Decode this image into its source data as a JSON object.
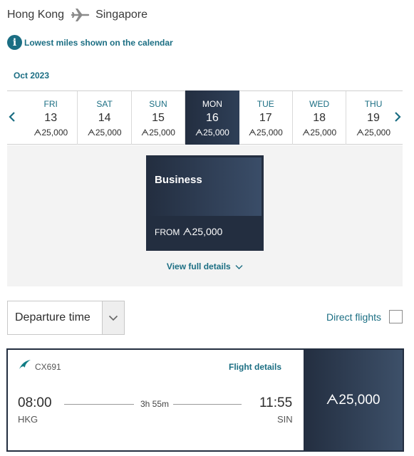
{
  "route": {
    "origin": "Hong Kong",
    "destination": "Singapore",
    "icon": "plane-icon"
  },
  "info": {
    "icon": "info-icon",
    "text": "Lowest miles shown on the calendar"
  },
  "calendar": {
    "month": "Oct 2023",
    "days": [
      {
        "dow": "FRI",
        "date": "13",
        "miles": "ᗅ25,000"
      },
      {
        "dow": "SAT",
        "date": "14",
        "miles": "ᗅ25,000"
      },
      {
        "dow": "SUN",
        "date": "15",
        "miles": "ᗅ25,000"
      },
      {
        "dow": "MON",
        "date": "16",
        "miles": "ᗅ25,000",
        "selected": true
      },
      {
        "dow": "TUE",
        "date": "17",
        "miles": "ᗅ25,000"
      },
      {
        "dow": "WED",
        "date": "18",
        "miles": "ᗅ25,000"
      },
      {
        "dow": "THU",
        "date": "19",
        "miles": "ᗅ25,000"
      }
    ]
  },
  "cabin_card": {
    "cabin": "Business",
    "from_label": "FROM",
    "price": "ᗅ25,000",
    "view_details": "View full details"
  },
  "filters": {
    "sort_value": "Departure time",
    "direct_label": "Direct flights"
  },
  "flight": {
    "number": "CX691",
    "details_link": "Flight details",
    "depart_time": "08:00",
    "depart_code": "HKG",
    "duration": "3h 55m",
    "arrive_time": "11:55",
    "arrive_code": "SIN",
    "price": "ᗅ25,000"
  },
  "colors": {
    "accent": "#1b6e83",
    "navy": "#232e40"
  }
}
